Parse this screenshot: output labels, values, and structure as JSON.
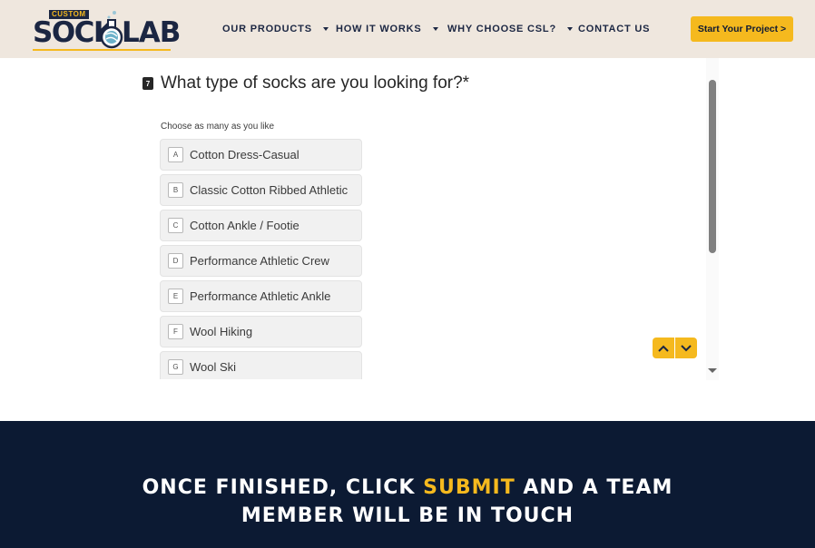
{
  "brand": {
    "logo_top": "CUSTOM",
    "logo_left": "SOCK",
    "logo_right": "LAB",
    "accent": "#f5b91e",
    "navy": "#1b2642"
  },
  "nav": {
    "products": "OUR PRODUCTS",
    "how": "HOW IT WORKS",
    "why": "WHY CHOOSE CSL?",
    "contact": "CONTACT US"
  },
  "cta_label": "Start Your Project >",
  "form": {
    "question_number": "7",
    "question": "What type of socks are you looking for?*",
    "hint": "Choose as many as you like",
    "options": [
      {
        "key": "A",
        "label": "Cotton Dress-Casual"
      },
      {
        "key": "B",
        "label": "Classic Cotton Ribbed Athletic"
      },
      {
        "key": "C",
        "label": "Cotton Ankle / Footie"
      },
      {
        "key": "D",
        "label": "Performance Athletic Crew"
      },
      {
        "key": "E",
        "label": "Performance Athletic Ankle"
      },
      {
        "key": "F",
        "label": "Wool Hiking"
      },
      {
        "key": "G",
        "label": "Wool Ski"
      }
    ]
  },
  "banner": {
    "line1_start": "ONCE FINISHED, CLICK ",
    "line1_highlight": "SUBMIT",
    "line1_end": " AND A TEAM",
    "line2": "MEMBER WILL BE IN TOUCH"
  }
}
